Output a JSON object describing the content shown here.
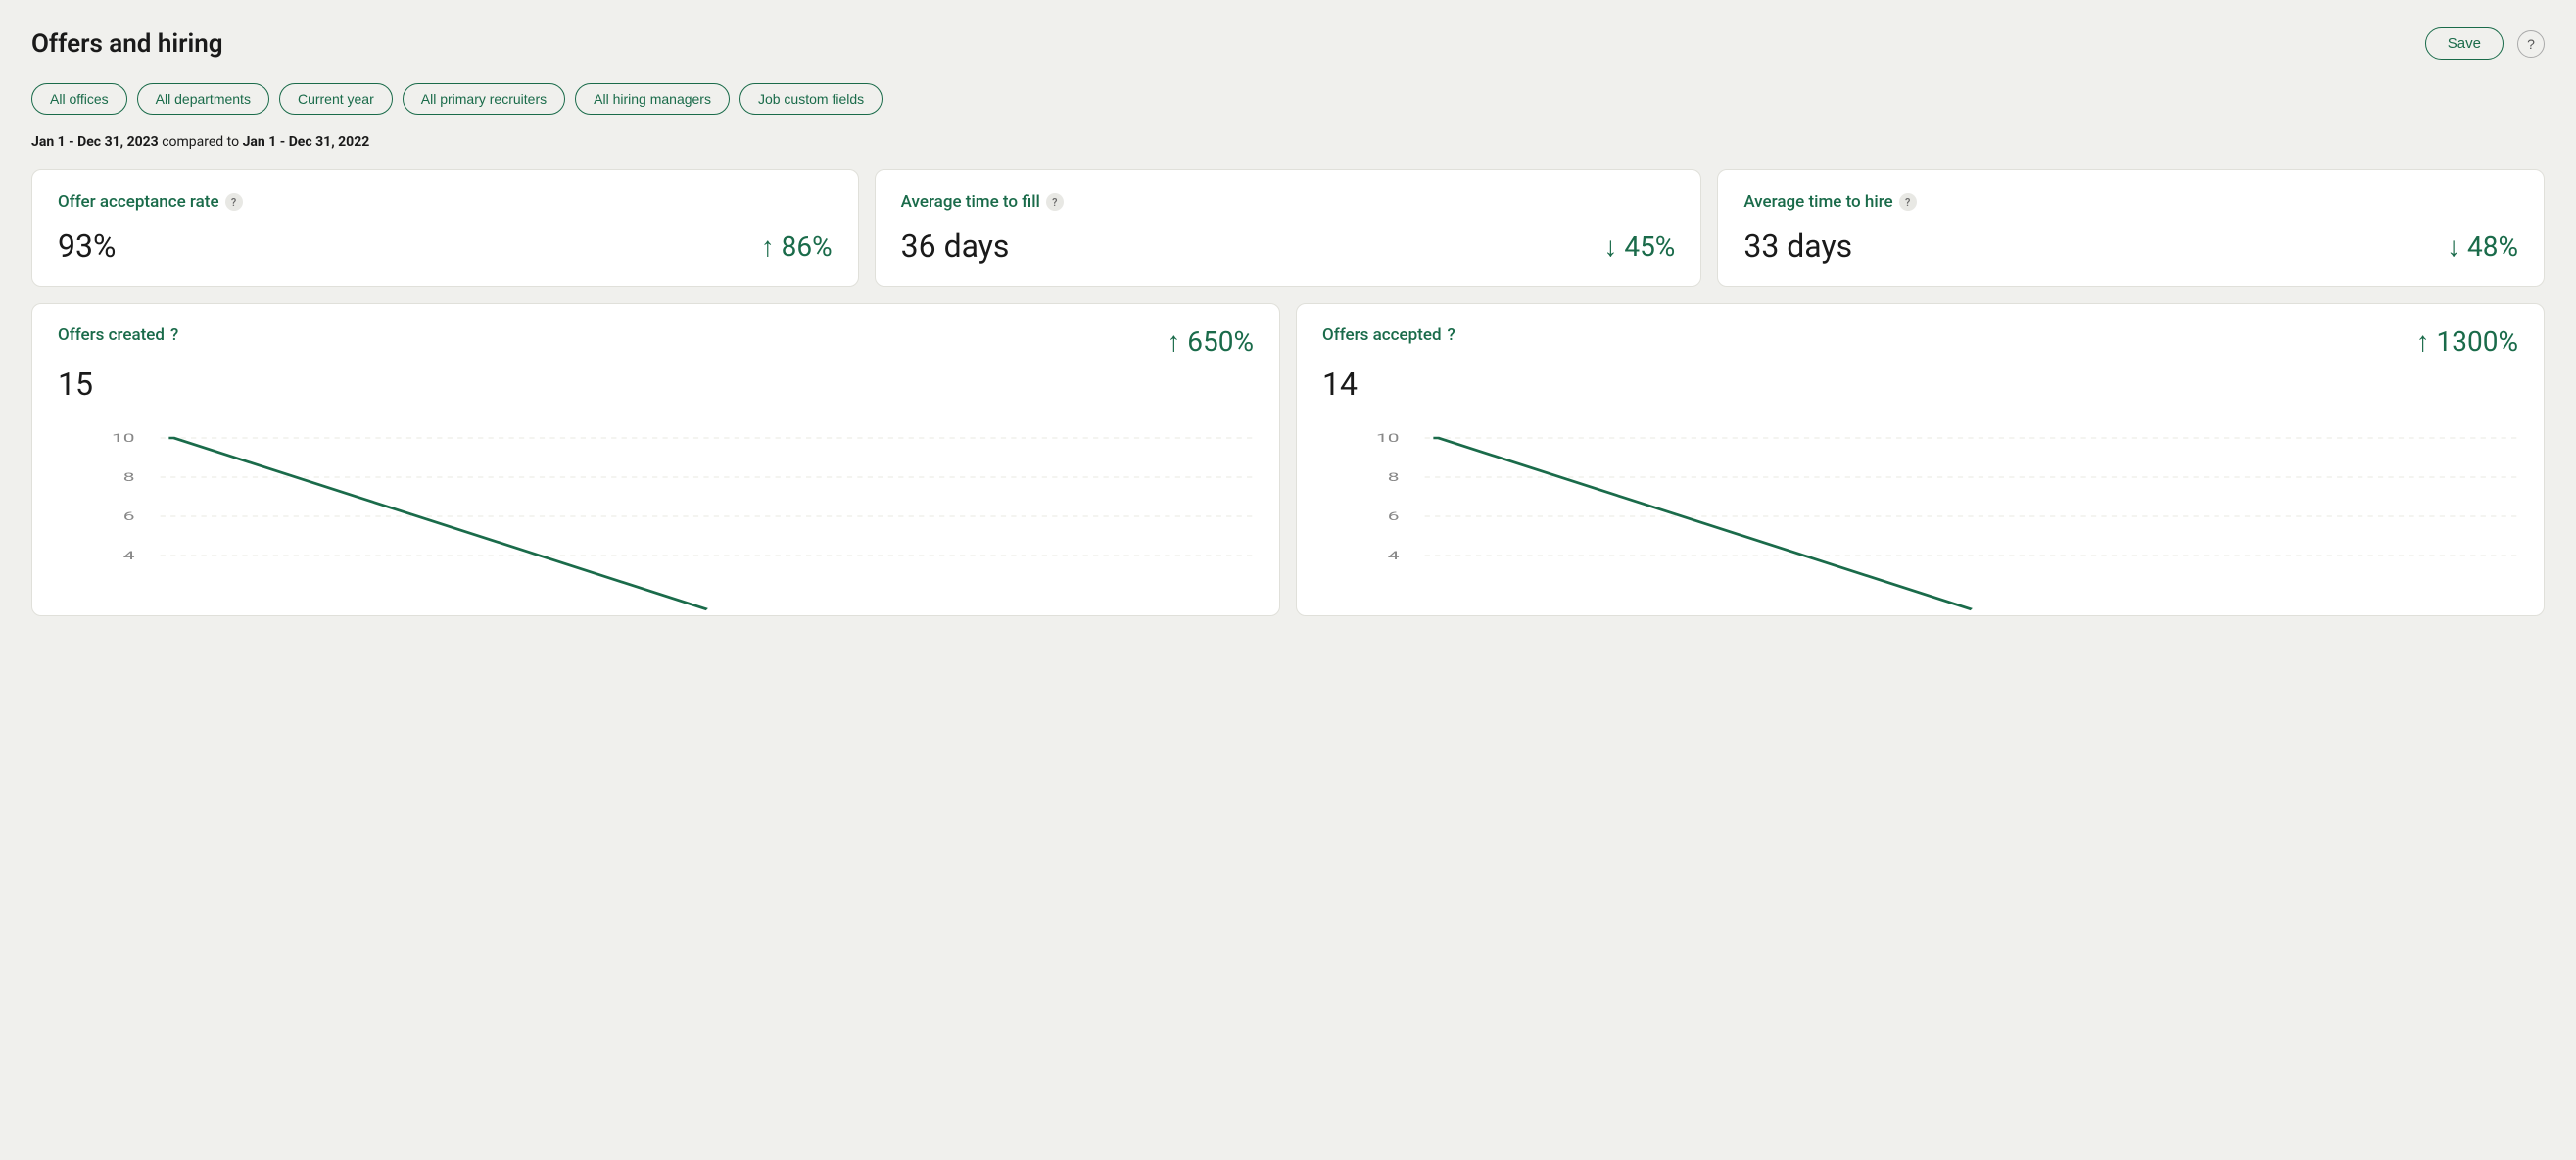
{
  "page": {
    "title": "Offers and hiring"
  },
  "header": {
    "save_label": "Save",
    "help_label": "?"
  },
  "filters": [
    {
      "id": "offices",
      "label": "All offices"
    },
    {
      "id": "departments",
      "label": "All departments"
    },
    {
      "id": "year",
      "label": "Current year"
    },
    {
      "id": "recruiters",
      "label": "All primary recruiters"
    },
    {
      "id": "hiring_managers",
      "label": "All hiring managers"
    },
    {
      "id": "custom_fields",
      "label": "Job custom fields"
    }
  ],
  "date_range": {
    "current": "Jan 1 - Dec 31, 2023",
    "comparison_label": "compared to",
    "previous": "Jan 1 - Dec 31, 2022"
  },
  "metrics": [
    {
      "id": "offer_acceptance_rate",
      "title": "Offer acceptance rate",
      "value": "93%",
      "change": "↑ 86%",
      "change_direction": "up"
    },
    {
      "id": "avg_time_to_fill",
      "title": "Average time to fill",
      "value": "36 days",
      "change": "↓ 45%",
      "change_direction": "down"
    },
    {
      "id": "avg_time_to_hire",
      "title": "Average time to hire",
      "value": "33 days",
      "change": "↓ 48%",
      "change_direction": "down"
    }
  ],
  "charts": [
    {
      "id": "offers_created",
      "title": "Offers created",
      "value": "15",
      "change": "↑ 650%",
      "change_direction": "up",
      "y_labels": [
        "10",
        "8",
        "6",
        "4"
      ],
      "line_points": "80,10 82,10 600,170"
    },
    {
      "id": "offers_accepted",
      "title": "Offers accepted",
      "value": "14",
      "change": "↑ 1300%",
      "change_direction": "up",
      "y_labels": [
        "10",
        "8",
        "6",
        "4"
      ],
      "line_points": "80,10 82,10 600,170"
    }
  ],
  "icons": {
    "question": "?"
  }
}
